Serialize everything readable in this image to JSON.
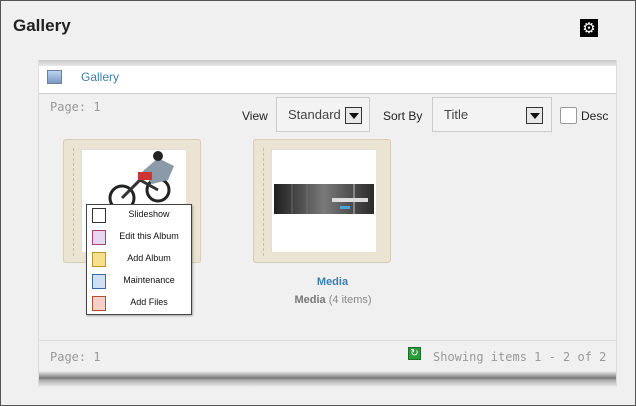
{
  "module": {
    "title": "Gallery",
    "settings_icon": "gear-icon"
  },
  "header": {
    "icon": "gallery-image-icon",
    "link": "Gallery"
  },
  "pager": {
    "top": "Page: 1",
    "bottom": "Page: 1"
  },
  "controls": {
    "view_label": "View",
    "view_value": "Standard",
    "sort_label": "Sort By",
    "sort_value": "Title",
    "desc_label": "Desc",
    "desc_checked": false
  },
  "albums": [
    {
      "title": "",
      "thumbnail": "bmx-rider-photo"
    },
    {
      "title": "Media",
      "name": "Media",
      "count": "(4 items)",
      "thumbnail": "forest-banner-image"
    }
  ],
  "context_menu": [
    {
      "label": "Slideshow",
      "icon": "slideshow-icon"
    },
    {
      "label": "Edit this Album",
      "icon": "edit-album-icon"
    },
    {
      "label": "Add Album",
      "icon": "add-album-icon"
    },
    {
      "label": "Maintenance",
      "icon": "maintenance-icon"
    },
    {
      "label": "Add Files",
      "icon": "add-files-icon"
    }
  ],
  "footer": {
    "refresh_icon": "refresh-icon",
    "showing": "Showing items 1 - 2 of 2"
  },
  "colors": {
    "link": "#3b7fb0",
    "album_frame": "#ece4d2",
    "refresh": "#2e9a3a"
  }
}
